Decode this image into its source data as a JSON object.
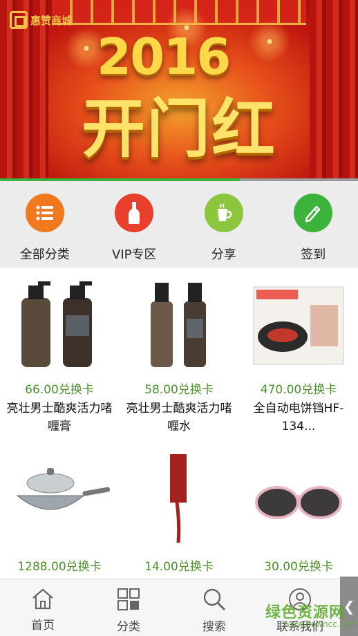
{
  "banner": {
    "logo_text": "惠赞商城",
    "year": "2016",
    "title": "开门红",
    "slide_progress": 0.67
  },
  "quicknav": [
    {
      "label": "全部分类",
      "icon": "list-icon",
      "color": "#f0781e"
    },
    {
      "label": "VIP专区",
      "icon": "bottle-icon",
      "color": "#e8402c"
    },
    {
      "label": "分享",
      "icon": "cup-icon",
      "color": "#8cc63f"
    },
    {
      "label": "签到",
      "icon": "pencil-icon",
      "color": "#3cb43c"
    }
  ],
  "products": [
    {
      "price": "66.00兑换卡",
      "name": "亮壮男士酷爽活力啫喱膏"
    },
    {
      "price": "58.00兑换卡",
      "name": "亮壮男士酷爽活力啫喱水"
    },
    {
      "price": "470.00兑换卡",
      "name": "全自动电饼铛HF-134..."
    },
    {
      "price": "1288.00兑换卡",
      "name": ""
    },
    {
      "price": "14.00兑换卡",
      "name": ""
    },
    {
      "price": "30.00兑换卡",
      "name": ""
    }
  ],
  "tabbar": [
    {
      "label": "首页",
      "icon": "home-icon"
    },
    {
      "label": "分类",
      "icon": "grid-icon"
    },
    {
      "label": "搜索",
      "icon": "search-icon"
    },
    {
      "label": "联系我们",
      "icon": "user-icon"
    }
  ],
  "watermark": {
    "text": "绿色资源网",
    "sub": "www.downcc.com"
  },
  "colors": {
    "price_green": "#4a8f2a",
    "nav_bg": "#ececec",
    "accent_green": "#3cb43c"
  }
}
